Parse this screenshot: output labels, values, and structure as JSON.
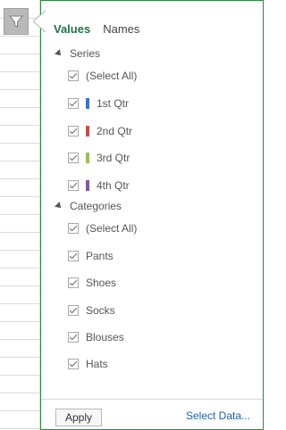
{
  "tabs": {
    "values": "Values",
    "names": "Names"
  },
  "series": {
    "label": "Series",
    "items": [
      {
        "label": "(Select All)",
        "checked": true,
        "color": ""
      },
      {
        "label": "1st Qtr",
        "checked": true,
        "color": "#3d72c8"
      },
      {
        "label": "2nd Qtr",
        "checked": true,
        "color": "#c0504d"
      },
      {
        "label": "3rd Qtr",
        "checked": true,
        "color": "#9bbb59"
      },
      {
        "label": "4th Qtr",
        "checked": true,
        "color": "#7f5aa2"
      }
    ]
  },
  "categories": {
    "label": "Categories",
    "items": [
      {
        "label": "(Select All)",
        "checked": true
      },
      {
        "label": "Pants",
        "checked": true
      },
      {
        "label": "Shoes",
        "checked": true
      },
      {
        "label": "Socks",
        "checked": true
      },
      {
        "label": "Blouses",
        "checked": true
      },
      {
        "label": "Hats",
        "checked": true
      }
    ]
  },
  "footer": {
    "apply": "Apply",
    "select_data": "Select Data..."
  },
  "icons": {
    "filter": "funnel-icon"
  }
}
